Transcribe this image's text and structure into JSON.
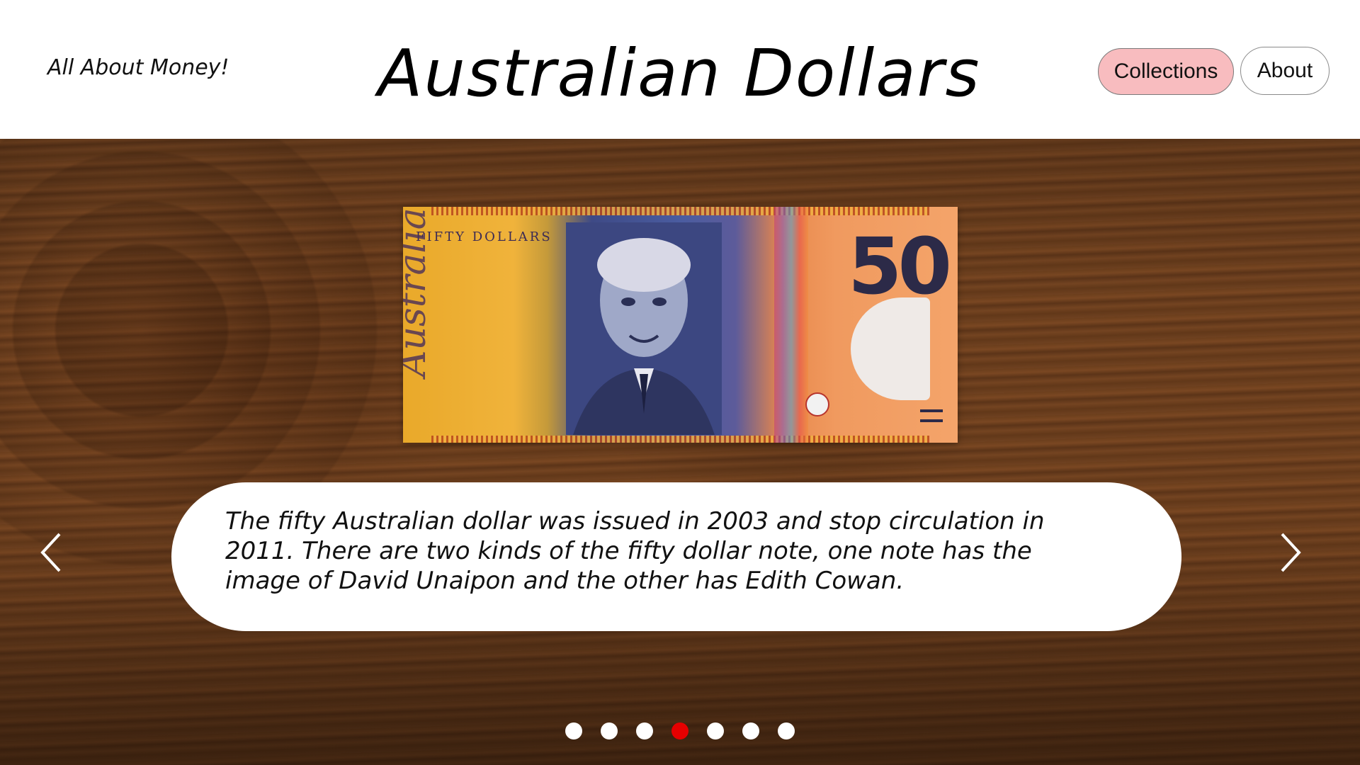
{
  "header": {
    "brand": "All About Money!",
    "title": "Australian Dollars",
    "nav": {
      "collections_label": "Collections",
      "about_label": "About"
    }
  },
  "slide": {
    "banknote": {
      "value_text": "50",
      "label_text": "FIFTY DOLLARS",
      "country_text": "Australia"
    },
    "caption": "The fifty Australian dollar was issued in 2003 and stop circulation in 2011. There are two kinds of the fifty dollar note, one note has the image of David Unaipon and the other has Edith Cowan."
  },
  "carousel": {
    "prev_icon": "chevron-left-icon",
    "next_icon": "chevron-right-icon",
    "slide_count": 7,
    "active_index": 3
  },
  "colors": {
    "active_dot": "#e60000",
    "inactive_dot": "#ffffff",
    "collections_button": "#f8bcbf",
    "header_background": "#ffffff",
    "caption_background": "#ffffff"
  }
}
